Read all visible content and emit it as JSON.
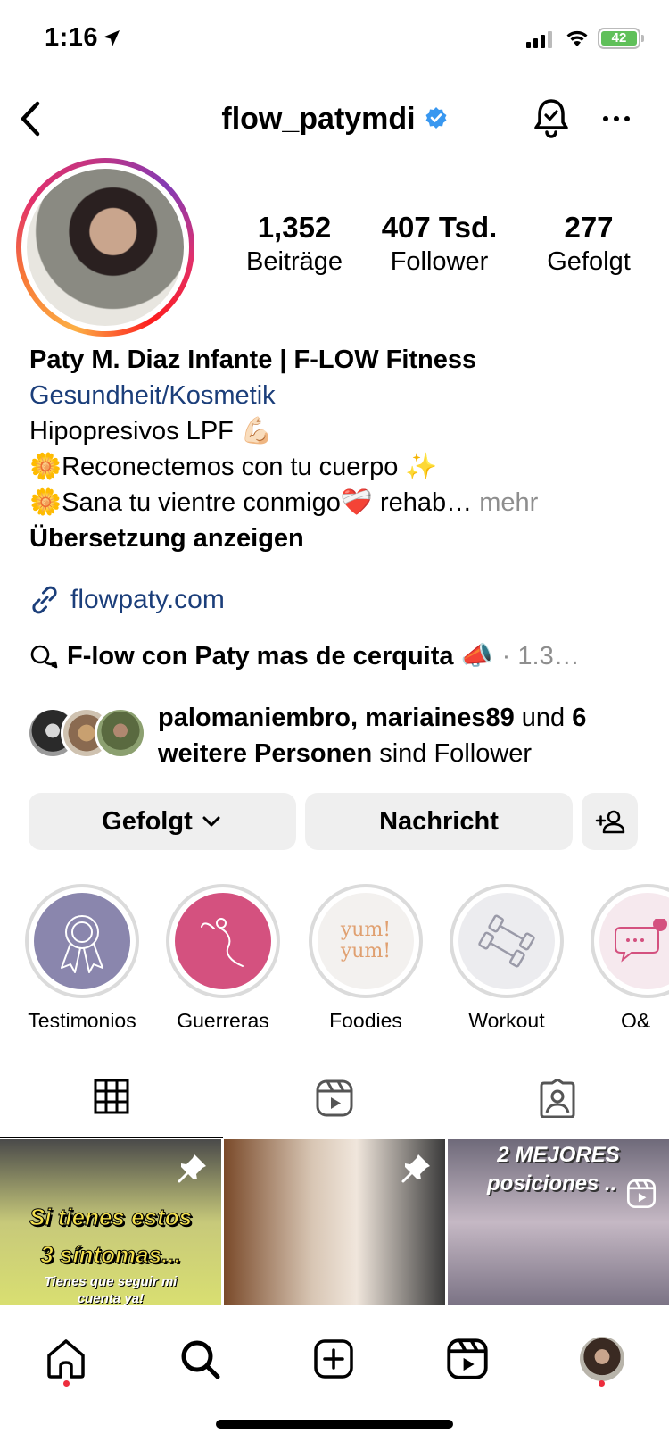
{
  "status_bar": {
    "time": "1:16",
    "battery": "42"
  },
  "header": {
    "username": "flow_patymdi"
  },
  "profile": {
    "stats": [
      {
        "value": "1,352",
        "label": "Beiträge"
      },
      {
        "value": "407 Tsd.",
        "label": "Follower"
      },
      {
        "value": "277",
        "label": "Gefolgt"
      }
    ],
    "name": "Paty M. Diaz Infante | F-LOW Fitness",
    "category": "Gesundheit/Kosmetik",
    "bio_line1": "Hipopresivos LPF 💪🏻",
    "bio_line2": "🌼Reconectemos con tu cuerpo ✨",
    "bio_line3": "🌼Sana tu vientre conmigo❤️‍🩹 rehab…",
    "bio_more": "mehr",
    "translate": "Übersetzung anzeigen",
    "link": "flowpaty.com",
    "thread_title": "F-low con Paty mas de cerquita 📣",
    "thread_count": "· 1.3…",
    "followed_by": {
      "user1": "palomaniembro",
      "sep": ", ",
      "user2": "mariaines89",
      "und": " und ",
      "others": "6 weitere Personen",
      "suffix": " sind Follower"
    }
  },
  "buttons": {
    "following": "Gefolgt",
    "message": "Nachricht"
  },
  "highlights": [
    {
      "label": "Testimonios",
      "color": "#8a86ad"
    },
    {
      "label": "Guerreras",
      "color": "#d4517f"
    },
    {
      "label": "Foodies",
      "color": "#f3f1ef",
      "text": "yum! yum!"
    },
    {
      "label": "Workout",
      "color": "#ececef"
    },
    {
      "label": "Q&",
      "color": "#f6e9ee"
    }
  ],
  "posts": [
    {
      "line1": "Si tienes estos",
      "line2": "3 síntomas...",
      "line3": "Tienes que seguir mi cuenta ya!"
    },
    {},
    {
      "line1": "2 MEJORES",
      "line2": "posiciones .."
    }
  ],
  "colors": {
    "link": "#1b3e7a",
    "button_bg": "#efefef",
    "verified": "#3897f0",
    "notification_dot": "#ed2d3d"
  }
}
